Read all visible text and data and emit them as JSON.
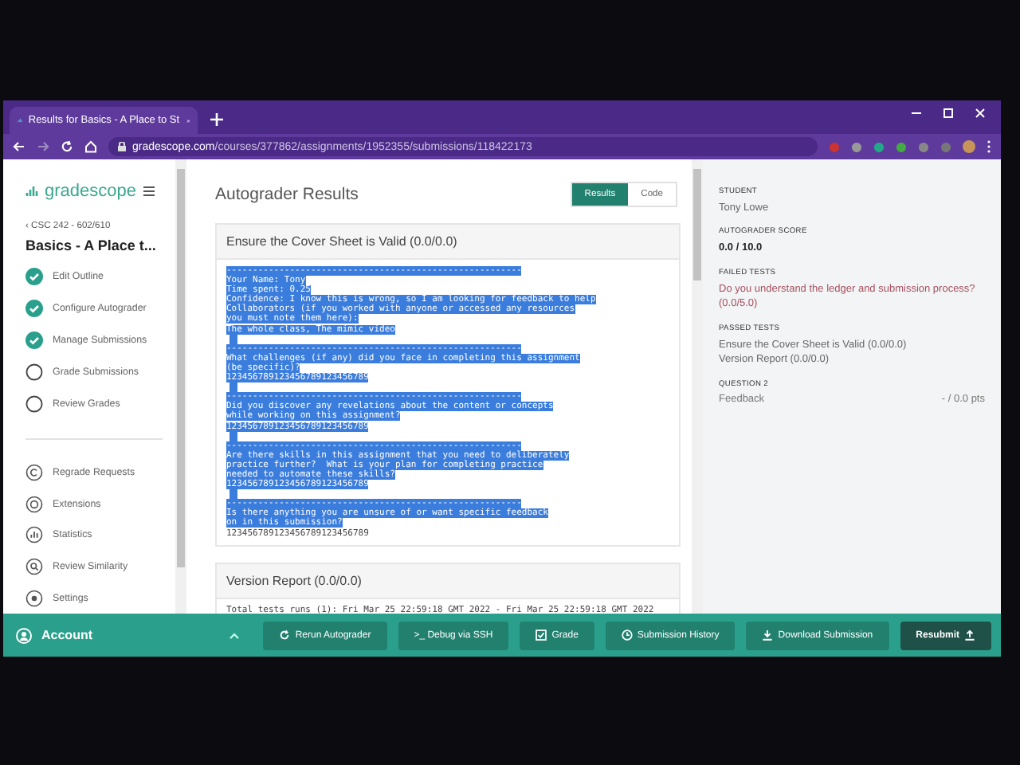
{
  "browser": {
    "tab_title": "Results for Basics - A Place to St",
    "url_host": "gradescope.com",
    "url_path": "/courses/377862/assignments/1952355/submissions/118422173"
  },
  "sidebar": {
    "logo": "gradescope",
    "course": "‹ CSC 242 - 602/610",
    "assignment": "Basics - A Place t...",
    "steps": [
      {
        "label": "Edit Outline",
        "checked": true
      },
      {
        "label": "Configure Autograder",
        "checked": true
      },
      {
        "label": "Manage Submissions",
        "checked": true
      },
      {
        "label": "Grade Submissions",
        "checked": false
      },
      {
        "label": "Review Grades",
        "checked": false
      }
    ],
    "nav": [
      {
        "label": "Regrade Requests",
        "kind": "regrade"
      },
      {
        "label": "Extensions",
        "kind": "extensions"
      },
      {
        "label": "Statistics",
        "kind": "statistics"
      },
      {
        "label": "Review Similarity",
        "kind": "similarity"
      },
      {
        "label": "Settings",
        "kind": "settings"
      }
    ]
  },
  "main": {
    "title": "Autograder Results",
    "tabs": [
      {
        "label": "Results",
        "selected": true
      },
      {
        "label": "Code",
        "selected": false
      }
    ],
    "tests": [
      {
        "title": "Ensure the Cover Sheet is Valid (0.0/0.0)",
        "lines": [
          {
            "text": "--------------------------------------------------------",
            "selected": true
          },
          {
            "text": "Your Name: Tony",
            "selected": true
          },
          {
            "text": "Time spent: 0.25",
            "selected": true
          },
          {
            "text": "Confidence: I know this is wrong, so I am looking for feedback to help",
            "selected": true
          },
          {
            "text": "Collaborators (if you worked with anyone or accessed any resources",
            "selected": true
          },
          {
            "text": "you must note them here):",
            "selected": true
          },
          {
            "text": "The whole class, The mimic video",
            "selected": true
          },
          {
            "selected": true
          },
          {
            "text": "--------------------------------------------------------",
            "selected": true
          },
          {
            "text": "What challenges (if any) did you face in completing this assignment",
            "selected": true
          },
          {
            "text": "(be specific)?",
            "selected": true
          },
          {
            "text": "123456789123456789123456789",
            "selected": true
          },
          {
            "selected": true
          },
          {
            "text": "--------------------------------------------------------",
            "selected": true
          },
          {
            "text": "Did you discover any revelations about the content or concepts",
            "selected": true
          },
          {
            "text": "while working on this assignment?",
            "selected": true
          },
          {
            "text": "123456789123456789123456789",
            "selected": true
          },
          {
            "selected": true
          },
          {
            "text": "--------------------------------------------------------",
            "selected": true
          },
          {
            "text": "Are there skills in this assignment that you need to deliberately",
            "selected": true
          },
          {
            "text": "practice further?  What is your plan for completing practice",
            "selected": true
          },
          {
            "text": "needed to automate these skills?",
            "selected": true
          },
          {
            "text": "123456789123456789123456789",
            "selected": true
          },
          {
            "selected": true
          },
          {
            "text": "--------------------------------------------------------",
            "selected": true
          },
          {
            "text": "Is there anything you are unsure of or want specific feedback",
            "selected": true
          },
          {
            "text": "on in this submission?",
            "selected": true
          },
          {
            "text": "123456789123456789123456789",
            "selected": false
          }
        ]
      },
      {
        "title": "Version Report (0.0/0.0)",
        "lines": [
          {
            "text": "Total tests runs (1): Fri Mar 25 22:59:18 GMT 2022 - Fri Mar 25 22:59:18 GMT 2022",
            "selected": false
          }
        ]
      }
    ]
  },
  "panel": {
    "student_label": "STUDENT",
    "student": "Tony Lowe",
    "score_label": "AUTOGRADER SCORE",
    "score": "0.0 / 10.0",
    "failed_label": "FAILED TESTS",
    "failed": [
      "Do you understand the ledger and submission process? (0.0/5.0)"
    ],
    "passed_label": "PASSED TESTS",
    "passed": [
      "Ensure the Cover Sheet is Valid (0.0/0.0)",
      "Version Report (0.0/0.0)"
    ],
    "question_label": "QUESTION 2",
    "question_item": "Feedback",
    "question_points": "- / 0.0 pts"
  },
  "bottom_bar": {
    "account": "Account",
    "buttons": [
      {
        "label": "Rerun Autograder",
        "kind": "rerun"
      },
      {
        "label": ">_ Debug via SSH",
        "kind": "plain"
      },
      {
        "label": "Grade",
        "kind": "grade"
      },
      {
        "label": "Submission History",
        "kind": "history"
      },
      {
        "label": "Download Submission",
        "kind": "download"
      },
      {
        "label": "Resubmit",
        "kind": "resubmit"
      }
    ]
  }
}
